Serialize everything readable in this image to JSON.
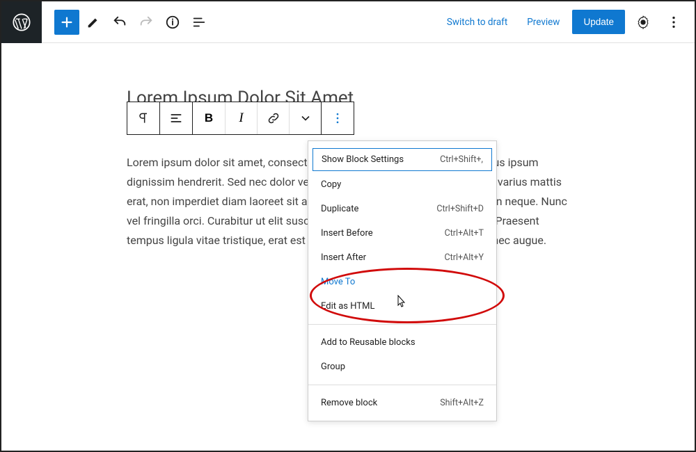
{
  "topbar": {
    "switchToDraft": "Switch to draft",
    "preview": "Preview",
    "update": "Update"
  },
  "post": {
    "title": "Lorem Ipsum Dolor Sit Amet",
    "body": "Lorem ipsum dolor sit amet, consectetur adipiscing elit. Mauris iaculis varius ipsum dignissim hendrerit. Sed nec dolor vehicula nunc egestas facilisis. Quisque varius mattis erat, non imperdiet diam laoreet sit amet. Aenean justo lacinia pulvinar vel in neque. Nunc vel fringilla orci. Curabitur ut elit suscipit lorem elementum, aliquam libero. Praesent tempus ligula vitae tristique, erat est pretium magna, ut hendrerit arcu nisl nec augue."
  },
  "blockMenu": {
    "sections": [
      [
        {
          "label": "Show Block Settings",
          "shortcut": "Ctrl+Shift+,",
          "focused": true
        },
        {
          "label": "Copy",
          "shortcut": ""
        },
        {
          "label": "Duplicate",
          "shortcut": "Ctrl+Shift+D"
        },
        {
          "label": "Insert Before",
          "shortcut": "Ctrl+Alt+T"
        },
        {
          "label": "Insert After",
          "shortcut": "Ctrl+Alt+Y"
        },
        {
          "label": "Move To",
          "shortcut": "",
          "highlight": true
        },
        {
          "label": "Edit as HTML",
          "shortcut": ""
        }
      ],
      [
        {
          "label": "Add to Reusable blocks",
          "shortcut": ""
        },
        {
          "label": "Group",
          "shortcut": ""
        }
      ],
      [
        {
          "label": "Remove block",
          "shortcut": "Shift+Alt+Z"
        }
      ]
    ]
  },
  "blockToolbar": {
    "bold": "B",
    "italic": "I"
  }
}
